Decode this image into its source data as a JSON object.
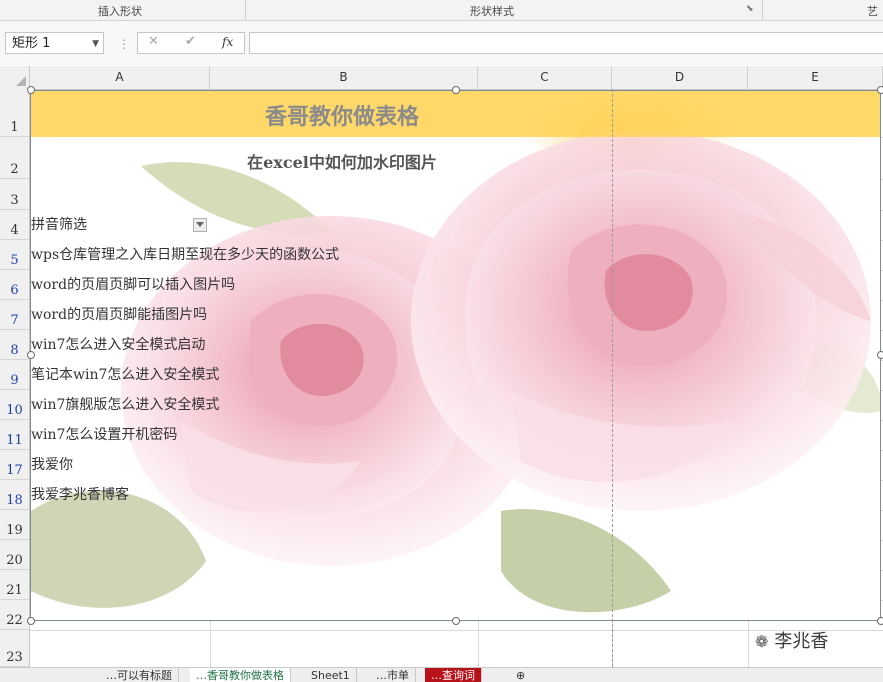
{
  "ribbon": {
    "group_insert_shape": "插入形状",
    "group_shape_style": "形状样式",
    "group_art_partial": "艺"
  },
  "formula_bar": {
    "name_box": "矩形 1",
    "cancel_symbol": "✕",
    "enter_symbol": "✔",
    "fx_label": "fx",
    "formula_value": ""
  },
  "columns": [
    "A",
    "B",
    "C",
    "D",
    "E"
  ],
  "rows": [
    {
      "num": "1",
      "text": "",
      "filtered": false
    },
    {
      "num": "2",
      "text": "",
      "filtered": false
    },
    {
      "num": "3",
      "text": "",
      "filtered": false
    },
    {
      "num": "4",
      "text": "拼音筛选",
      "filtered": false
    },
    {
      "num": "5",
      "text": "wps仓库管理之入库日期至现在多少天的函数公式",
      "filtered": true
    },
    {
      "num": "6",
      "text": "word的页眉页脚可以插入图片吗",
      "filtered": true
    },
    {
      "num": "7",
      "text": "word的页眉页脚能插图片吗",
      "filtered": true
    },
    {
      "num": "8",
      "text": "win7怎么进入安全模式启动",
      "filtered": true
    },
    {
      "num": "9",
      "text": "笔记本win7怎么进入安全模式",
      "filtered": true
    },
    {
      "num": "10",
      "text": "win7旗舰版怎么进入安全模式",
      "filtered": true
    },
    {
      "num": "11",
      "text": "win7怎么设置开机密码",
      "filtered": true
    },
    {
      "num": "17",
      "text": "我爱你",
      "filtered": true
    },
    {
      "num": "18",
      "text": "我爱李兆香博客",
      "filtered": true
    },
    {
      "num": "19",
      "text": "",
      "filtered": false
    },
    {
      "num": "20",
      "text": "",
      "filtered": false
    },
    {
      "num": "21",
      "text": "",
      "filtered": false
    },
    {
      "num": "22",
      "text": "",
      "filtered": false
    },
    {
      "num": "23",
      "text": "",
      "filtered": false
    }
  ],
  "shape": {
    "title": "香哥教你做表格",
    "subtitle": "在excel中如何加水印图片",
    "band_color": "#ffd45a",
    "image_subject": "pink-roses"
  },
  "watermark": {
    "text": "李兆香",
    "icon": "wechat-icon"
  },
  "sheet_tabs": [
    {
      "label": "…可以有标题",
      "style": "normal"
    },
    {
      "label": "…香哥教你做表格",
      "style": "active"
    },
    {
      "label": "Sheet1",
      "style": "normal"
    },
    {
      "label": "…市单",
      "style": "normal"
    },
    {
      "label": "…查询词",
      "style": "red"
    }
  ]
}
